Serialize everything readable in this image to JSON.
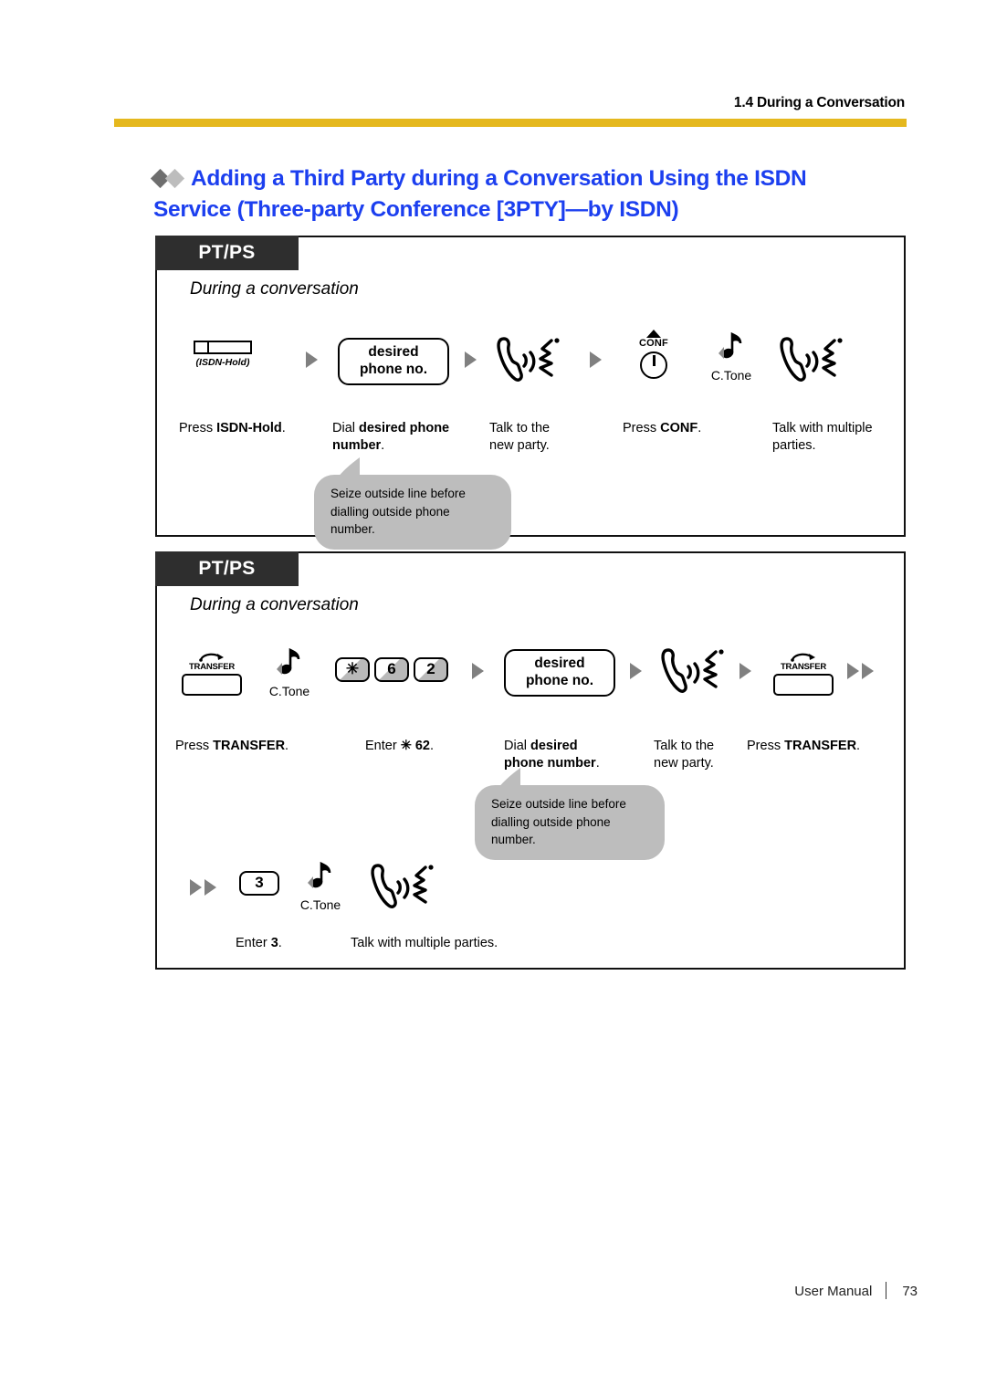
{
  "header": {
    "section_title": "1.4 During a Conversation",
    "rule_color": "#E5B81E"
  },
  "title": {
    "line1": "Adding a Third Party during a Conversation Using the ISDN",
    "line2": "Service (Three-party Conference [3PTY]—by ISDN)",
    "color": "#1C3FEF"
  },
  "panels": [
    {
      "tab_label": "PT/PS",
      "subtitle": "During a conversation",
      "steps": [
        {
          "icon": "isdn-hold-button",
          "icon_label": "(ISDN-Hold)",
          "caption_prefix": "Press ",
          "caption_bold": "ISDN-Hold",
          "caption_suffix": "."
        },
        {
          "icon": "phone-number-box",
          "box_line1": "desired",
          "box_line2": "phone no.",
          "caption_prefix": "Dial ",
          "caption_bold": "desired phone number",
          "caption_suffix": "."
        },
        {
          "icon": "talk-handset",
          "caption_prefix": "Talk to the new party.",
          "caption_bold": "",
          "caption_suffix": ""
        },
        {
          "icon": "conf-button",
          "icon_label": "CONF",
          "caption_prefix": "Press ",
          "caption_bold": "CONF",
          "caption_suffix": "."
        },
        {
          "icon": "talk-handset",
          "tone_label": "C.Tone",
          "caption_prefix": "Talk with multiple parties.",
          "caption_bold": "",
          "caption_suffix": ""
        }
      ],
      "bubble": {
        "line1": "Seize outside line before",
        "line2": "dialling outside phone number.",
        "color": "#BDBDBD"
      }
    },
    {
      "tab_label": "PT/PS",
      "subtitle": "During a conversation",
      "steps": [
        {
          "icon": "transfer-button",
          "icon_label": "TRANSFER",
          "caption_prefix": "Press ",
          "caption_bold": "TRANSFER",
          "caption_suffix": "."
        },
        {
          "icon": "tone-note",
          "tone_label": "C.Tone"
        },
        {
          "icon": "keypad",
          "keys": [
            "✳",
            "6",
            "2"
          ],
          "caption_prefix": "Enter ",
          "caption_bold": "✳ 62",
          "caption_suffix": "."
        },
        {
          "icon": "phone-number-box",
          "box_line1": "desired",
          "box_line2": "phone no.",
          "caption_prefix": "Dial ",
          "caption_bold_l1": "desired",
          "caption_bold_l2": "phone number",
          "caption_suffix": "."
        },
        {
          "icon": "talk-handset",
          "caption_prefix": "Talk to the new party."
        },
        {
          "icon": "transfer-button",
          "icon_label": "TRANSFER",
          "caption_prefix": "Press ",
          "caption_bold": "TRANSFER",
          "caption_suffix": "."
        }
      ],
      "bubble": {
        "line1": "Seize outside line before",
        "line2": "dialling outside phone number.",
        "color": "#BDBDBD"
      },
      "second_row": {
        "key": "3",
        "tone_label": "C.Tone",
        "caption_prefix": "Enter ",
        "caption_bold": "3",
        "caption_suffix": ".",
        "caption_talk": "Talk with multiple parties."
      }
    }
  ],
  "footer": {
    "doc_label": "User Manual",
    "page_number": "73"
  }
}
